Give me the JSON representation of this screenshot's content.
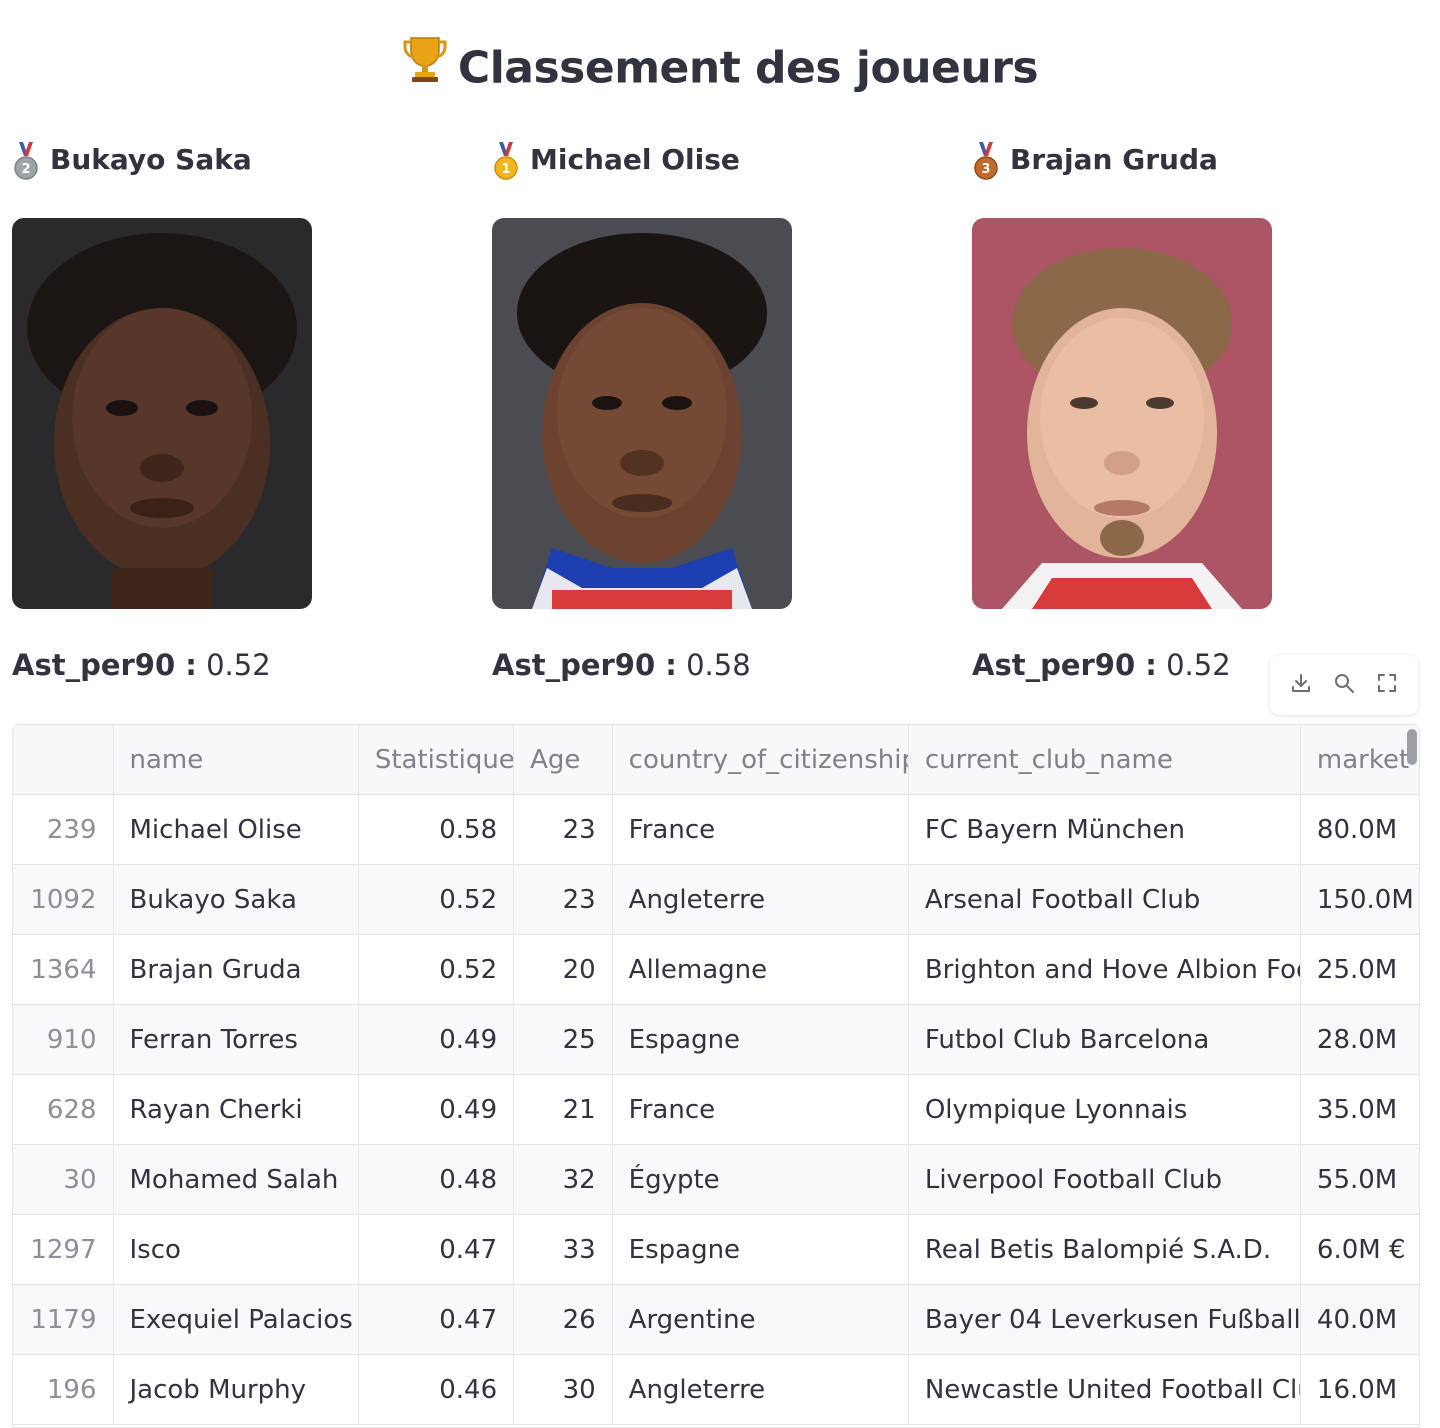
{
  "header": {
    "title": "Classement des joueurs",
    "icon": "trophy-icon"
  },
  "podium": [
    {
      "medal_icon": "silver-medal-icon",
      "medal_rank": "2",
      "medal_color": "#9ea3a8",
      "name": "Bukayo Saka",
      "stat_label": "Ast_per90 :",
      "stat_value": "0.52"
    },
    {
      "medal_icon": "gold-medal-icon",
      "medal_rank": "1",
      "medal_color": "#f2b51e",
      "name": "Michael Olise",
      "stat_label": "Ast_per90 :",
      "stat_value": "0.58"
    },
    {
      "medal_icon": "bronze-medal-icon",
      "medal_rank": "3",
      "medal_color": "#c06a2b",
      "name": "Brajan Gruda",
      "stat_label": "Ast_per90 :",
      "stat_value": "0.52"
    }
  ],
  "toolbar": {
    "download_icon": "download-icon",
    "search_icon": "search-icon",
    "fullscreen_icon": "fullscreen-icon"
  },
  "table": {
    "columns": [
      "",
      "name",
      "Statistique",
      "Age",
      "country_of_citizenship",
      "current_club_name",
      "market"
    ],
    "rows": [
      [
        "239",
        "Michael Olise",
        "0.58",
        "23",
        "France",
        "FC Bayern München",
        "80.0M"
      ],
      [
        "1092",
        "Bukayo Saka",
        "0.52",
        "23",
        "Angleterre",
        "Arsenal Football Club",
        "150.0M"
      ],
      [
        "1364",
        "Brajan Gruda",
        "0.52",
        "20",
        "Allemagne",
        "Brighton and Hove Albion Footba",
        "25.0M"
      ],
      [
        "910",
        "Ferran Torres",
        "0.49",
        "25",
        "Espagne",
        "Futbol Club Barcelona",
        "28.0M"
      ],
      [
        "628",
        "Rayan Cherki",
        "0.49",
        "21",
        "France",
        "Olympique Lyonnais",
        "35.0M"
      ],
      [
        "30",
        "Mohamed Salah",
        "0.48",
        "32",
        "Égypte",
        "Liverpool Football Club",
        "55.0M"
      ],
      [
        "1297",
        "Isco",
        "0.47",
        "33",
        "Espagne",
        "Real Betis Balompié S.A.D.",
        "6.0M €"
      ],
      [
        "1179",
        "Exequiel Palacios",
        "0.47",
        "26",
        "Argentine",
        "Bayer 04 Leverkusen Fußball",
        "40.0M"
      ],
      [
        "196",
        "Jacob Murphy",
        "0.46",
        "30",
        "Angleterre",
        "Newcastle United Football Club",
        "16.0M"
      ]
    ]
  }
}
